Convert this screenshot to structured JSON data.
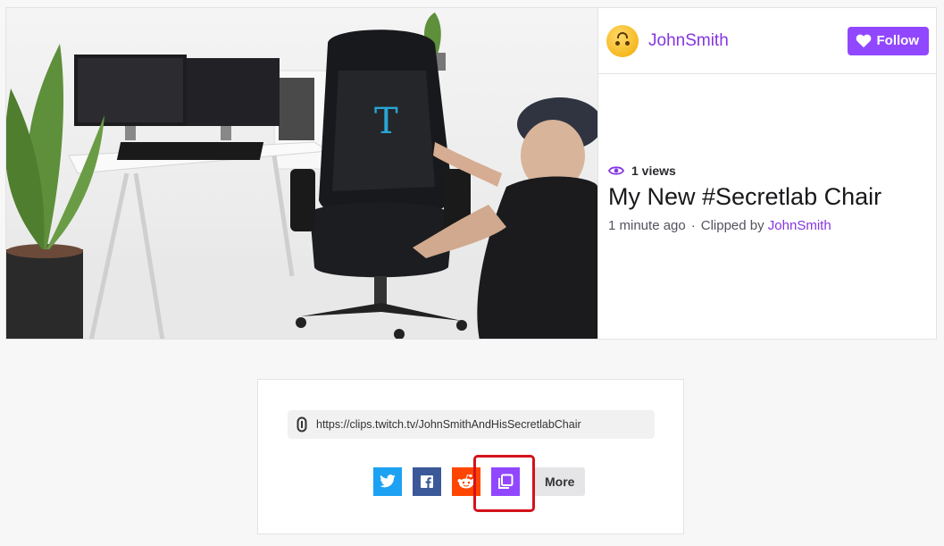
{
  "clip_card": {
    "video_alt": "video-thumbnail",
    "broadcaster": {
      "name": "JohnSmith"
    },
    "follow_label": "Follow",
    "views": "1 views",
    "title": "My New #Secretlab Chair",
    "time_ago": "1 minute ago",
    "separator": "·",
    "clipped_by_label": "Clipped by",
    "clipped_by": "JohnSmith"
  },
  "share": {
    "url": "https://clips.twitch.tv/JohnSmithAndHisSecretlabChair",
    "buttons": [
      {
        "name": "twitter",
        "icon": "twitter-icon",
        "color": "#1da1f2"
      },
      {
        "name": "facebook",
        "icon": "facebook-icon",
        "color": "#3b5998"
      },
      {
        "name": "reddit",
        "icon": "reddit-icon",
        "color": "#ff4500"
      },
      {
        "name": "copy",
        "icon": "copy-icon",
        "color": "#9147ff"
      }
    ],
    "more_label": "More"
  },
  "colors": {
    "accent": "#9147ff",
    "link": "#8436e0",
    "highlight": "#d4121c"
  }
}
